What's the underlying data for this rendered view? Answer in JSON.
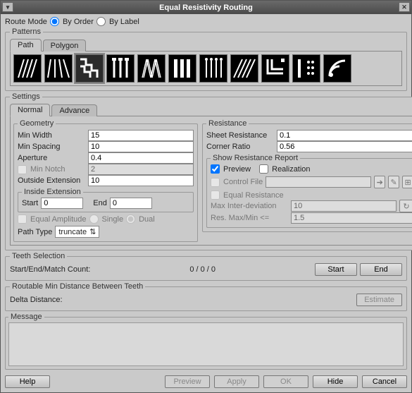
{
  "title": "Equal Resistivity Routing",
  "routeMode": {
    "label": "Route Mode",
    "byOrder": "By Order",
    "byLabel": "By Label"
  },
  "patterns": {
    "label": "Patterns",
    "tabs": {
      "path": "Path",
      "polygon": "Polygon"
    }
  },
  "settings": {
    "label": "Settings",
    "tabs": {
      "normal": "Normal",
      "advance": "Advance"
    },
    "geometry": {
      "label": "Geometry",
      "minWidth": {
        "label": "Min Width",
        "value": "15"
      },
      "minSpacing": {
        "label": "Min Spacing",
        "value": "10"
      },
      "aperture": {
        "label": "Aperture",
        "value": "0.4"
      },
      "minNotch": {
        "label": "Min Notch",
        "value": "2"
      },
      "outsideExt": {
        "label": "Outside Extension",
        "value": "10"
      },
      "insideExt": {
        "label": "Inside Extension",
        "start": {
          "label": "Start",
          "value": "0"
        },
        "end": {
          "label": "End",
          "value": "0"
        }
      },
      "equalAmp": {
        "label": "Equal Amplitude",
        "single": "Single",
        "dual": "Dual"
      },
      "pathType": {
        "label": "Path Type",
        "value": "truncate"
      }
    },
    "resistance": {
      "label": "Resistance",
      "sheet": {
        "label": "Sheet Resistance",
        "value": "0.1"
      },
      "cornerRatio": {
        "label": "Corner Ratio",
        "value": "0.56"
      },
      "report": {
        "label": "Show Resistance Report",
        "preview": "Preview",
        "realization": "Realization",
        "controlFile": "Control File",
        "equalRes": "Equal Resistance",
        "maxInter": {
          "label": "Max Inter-deviation",
          "value": "10"
        },
        "resMaxMin": {
          "label": "Res.  Max/Min <=",
          "value": "1.5"
        }
      }
    }
  },
  "teeth": {
    "label": "Teeth Selection",
    "countLabel": "Start/End/Match Count:",
    "countValue": "0 / 0 / 0",
    "start": "Start",
    "end": "End"
  },
  "routable": {
    "label": "Routable Min Distance Between Teeth",
    "delta": "Delta Distance:",
    "estimate": "Estimate"
  },
  "message": {
    "label": "Message"
  },
  "footer": {
    "help": "Help",
    "preview": "Preview",
    "apply": "Apply",
    "ok": "OK",
    "hide": "Hide",
    "cancel": "Cancel"
  }
}
